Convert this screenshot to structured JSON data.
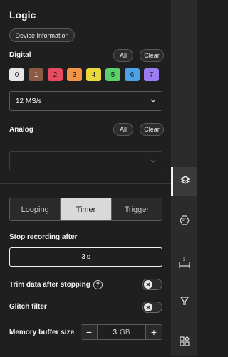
{
  "header": {
    "title": "Logic",
    "device_info_label": "Device Information"
  },
  "digital": {
    "label": "Digital",
    "all_label": "All",
    "clear_label": "Clear",
    "channels": [
      {
        "label": "0",
        "color": "#e6e6e6"
      },
      {
        "label": "1",
        "color": "#8a5a44"
      },
      {
        "label": "2",
        "color": "#e84a5f"
      },
      {
        "label": "3",
        "color": "#f29544"
      },
      {
        "label": "4",
        "color": "#e8d83a"
      },
      {
        "label": "5",
        "color": "#5bd16b"
      },
      {
        "label": "6",
        "color": "#4aa3e8"
      },
      {
        "label": "7",
        "color": "#9b7cf2"
      }
    ],
    "sample_rate": "12 MS/s"
  },
  "analog": {
    "label": "Analog",
    "all_label": "All",
    "clear_label": "Clear",
    "sample_rate": ""
  },
  "capture_mode": {
    "options": [
      "Looping",
      "Timer",
      "Trigger"
    ],
    "selected": "Timer"
  },
  "stop_recording": {
    "label": "Stop recording after",
    "value": "3",
    "unit": "s"
  },
  "trim_data": {
    "label": "Trim data after stopping",
    "help": "?",
    "enabled": false
  },
  "glitch_filter": {
    "label": "Glitch filter",
    "enabled": false
  },
  "memory_buffer": {
    "label": "Memory buffer size",
    "value": "3",
    "unit": "GB",
    "minus": "−",
    "plus": "+"
  },
  "rail": {
    "items": [
      "layers-icon",
      "analyzer-icon",
      "measure-icon",
      "trigger-icon",
      "extensions-icon"
    ],
    "measure_label": "3",
    "analyzer_label": "1F"
  }
}
